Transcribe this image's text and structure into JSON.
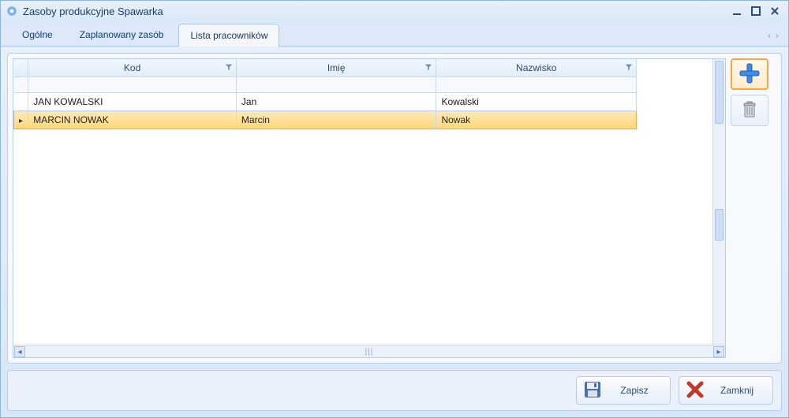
{
  "window": {
    "title": "Zasoby produkcyjne Spawarka"
  },
  "tabs": [
    {
      "label": "Ogólne",
      "active": false
    },
    {
      "label": "Zaplanowany zasób",
      "active": false
    },
    {
      "label": "Lista pracowników",
      "active": true
    }
  ],
  "grid": {
    "columns": [
      {
        "label": "Kod"
      },
      {
        "label": "Imię"
      },
      {
        "label": "Nazwisko"
      }
    ],
    "rows": [
      {
        "kod": "JAN KOWALSKI",
        "imie": "Jan",
        "nazwisko": "Kowalski",
        "selected": false
      },
      {
        "kod": "MARCIN NOWAK",
        "imie": "Marcin",
        "nazwisko": "Nowak",
        "selected": true
      }
    ]
  },
  "sideButtons": {
    "add": "add-icon",
    "delete": "trash-icon"
  },
  "footer": {
    "save": "Zapisz",
    "close": "Zamknij"
  }
}
